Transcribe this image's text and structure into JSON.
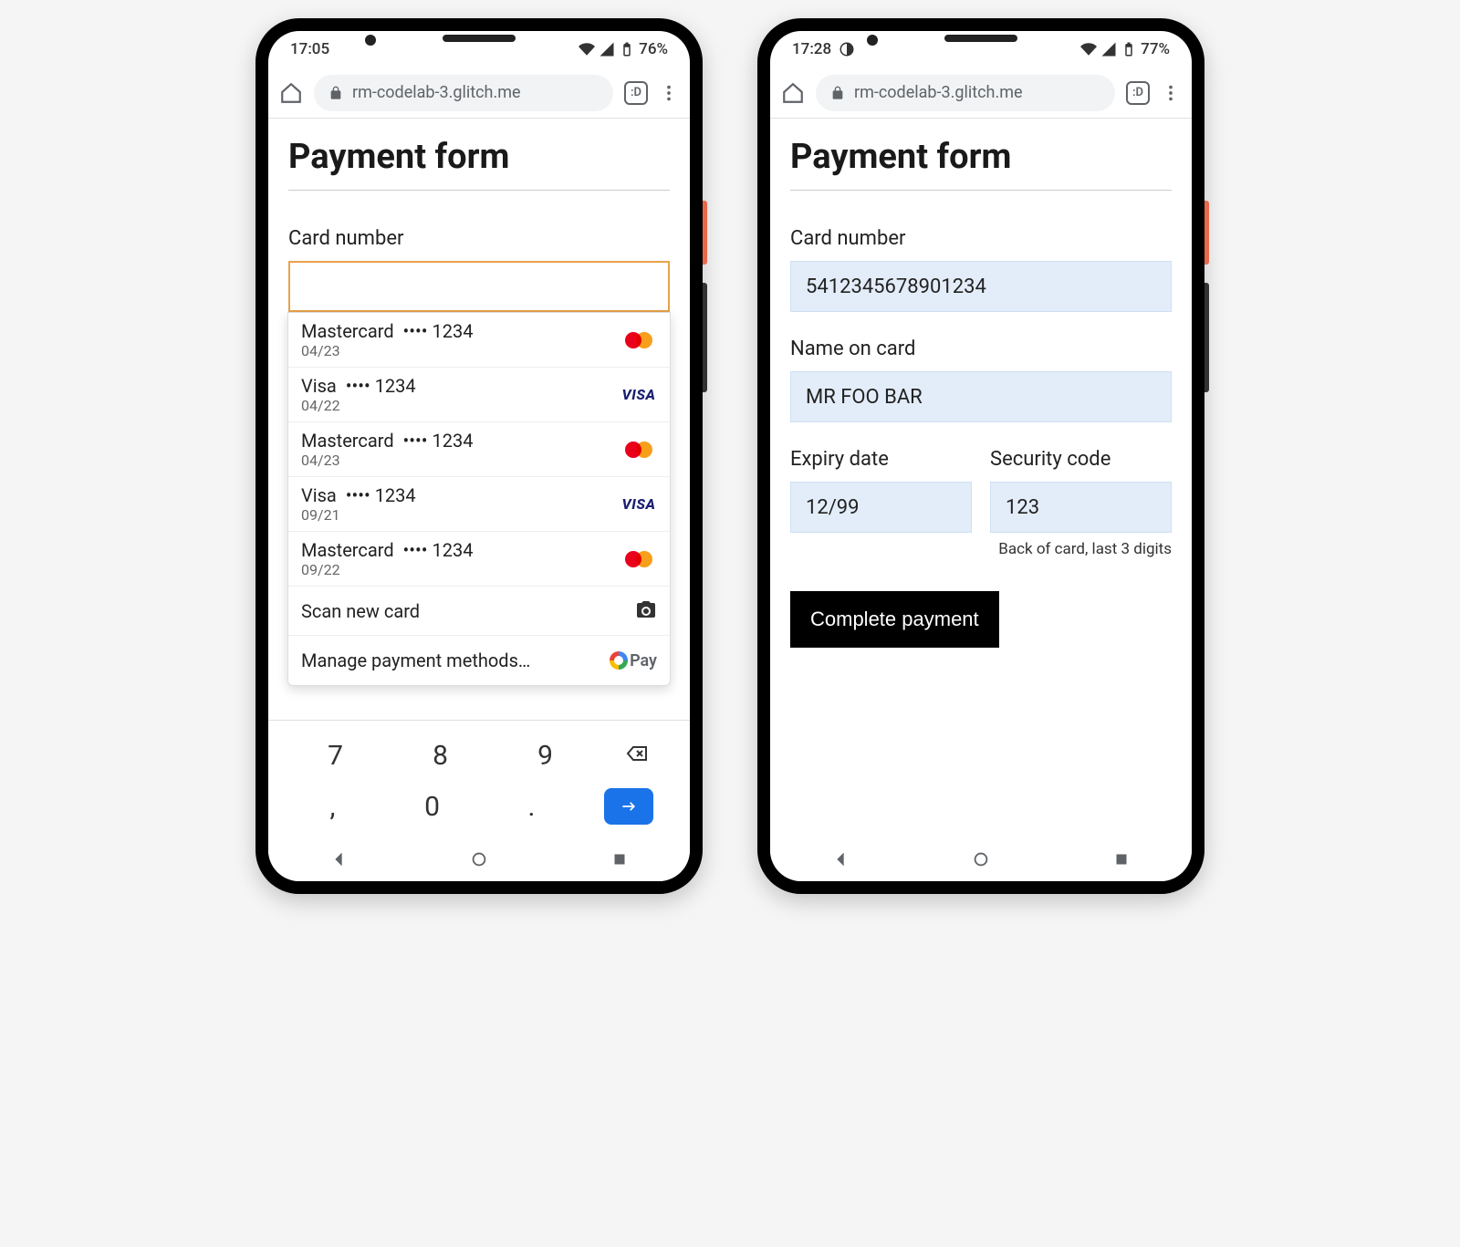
{
  "left": {
    "status": {
      "time": "17:05",
      "battery": "76%"
    },
    "browser": {
      "url": "rm-codelab-3.glitch.me",
      "tab_count": ":D"
    },
    "title": "Payment form",
    "card_label": "Card number",
    "autofill": [
      {
        "brand": "Mastercard",
        "last4": "1234",
        "exp": "04/23",
        "type": "mc"
      },
      {
        "brand": "Visa",
        "last4": "1234",
        "exp": "04/22",
        "type": "visa"
      },
      {
        "brand": "Mastercard",
        "last4": "1234",
        "exp": "04/23",
        "type": "mc"
      },
      {
        "brand": "Visa",
        "last4": "1234",
        "exp": "09/21",
        "type": "visa"
      },
      {
        "brand": "Mastercard",
        "last4": "1234",
        "exp": "09/22",
        "type": "mc"
      }
    ],
    "scan_label": "Scan new card",
    "manage_label": "Manage payment methods…",
    "gpay": "Pay",
    "keys_row1": [
      "7",
      "8",
      "9"
    ],
    "keys_row2": [
      ",",
      "0",
      "."
    ]
  },
  "right": {
    "status": {
      "time": "17:28",
      "battery": "77%"
    },
    "browser": {
      "url": "rm-codelab-3.glitch.me",
      "tab_count": ":D"
    },
    "title": "Payment form",
    "card_label": "Card number",
    "card_value": "5412345678901234",
    "name_label": "Name on card",
    "name_value": "MR FOO BAR",
    "expiry_label": "Expiry date",
    "expiry_value": "12/99",
    "cvc_label": "Security code",
    "cvc_value": "123",
    "cvc_help": "Back of card, last 3 digits",
    "submit": "Complete payment"
  }
}
